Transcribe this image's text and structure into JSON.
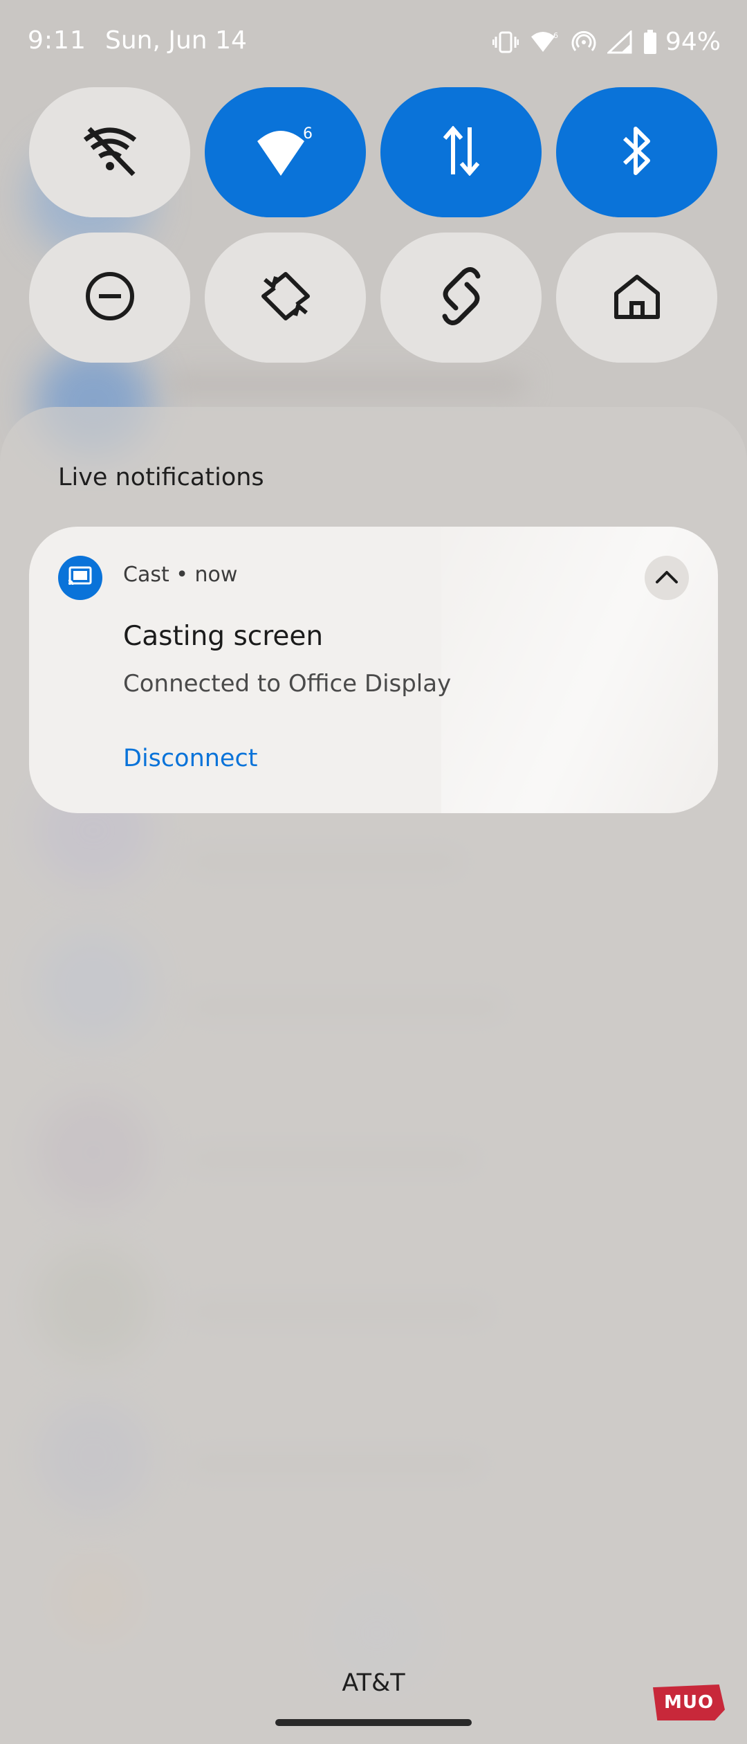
{
  "status_bar": {
    "time": "9:11",
    "date": "Sun, Jun 14",
    "battery": "94%",
    "icons": [
      "vibrate-icon",
      "wifi-6-icon",
      "hotspot-icon",
      "signal-icon",
      "battery-icon"
    ]
  },
  "quick_settings": [
    {
      "name": "wifi-off",
      "icon": "wifi-off-icon",
      "state": "off"
    },
    {
      "name": "wifi-6",
      "icon": "wifi-6-icon",
      "state": "on"
    },
    {
      "name": "mobile-data",
      "icon": "data-arrows-icon",
      "state": "on"
    },
    {
      "name": "bluetooth",
      "icon": "bluetooth-icon",
      "state": "on"
    },
    {
      "name": "do-not-disturb",
      "icon": "minus-circle-icon",
      "state": "off"
    },
    {
      "name": "auto-rotate",
      "icon": "rotate-icon",
      "state": "off"
    },
    {
      "name": "link",
      "icon": "link-icon",
      "state": "off"
    },
    {
      "name": "home",
      "icon": "home-icon",
      "state": "off"
    }
  ],
  "colors": {
    "accent": "#0a73d9",
    "tile_off": "#e4e2e0",
    "card": "#f2f0ee"
  },
  "shade": {
    "section_title": "Live notifications"
  },
  "notification": {
    "app": "Cast",
    "separator": "•",
    "time": "now",
    "title": "Casting screen",
    "text": "Connected to Office Display",
    "action": "Disconnect",
    "app_icon": "cast-icon"
  },
  "carrier": "AT&T",
  "watermark": "MUO"
}
